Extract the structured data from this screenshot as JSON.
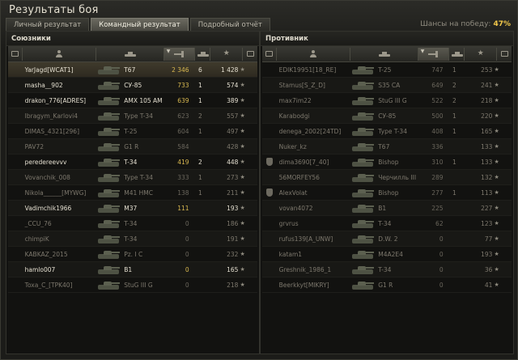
{
  "window": {
    "title": "Результаты боя"
  },
  "tabs": [
    {
      "label": "Личный результат"
    },
    {
      "label": "Командный результат"
    },
    {
      "label": "Подробный отчёт"
    }
  ],
  "win_chance": {
    "label": "Шансы на победу:",
    "value": "47%"
  },
  "allies": {
    "title": "Союзники",
    "rows": [
      {
        "name": "YarJagd[WCAT1]",
        "tank": "T67",
        "dmg": "2 346",
        "frags": "6",
        "xp": "1 428",
        "alive": true,
        "dmg_style": "Y",
        "medal": true,
        "highlight": true
      },
      {
        "name": "masha__902",
        "tank": "СУ-85",
        "dmg": "733",
        "frags": "1",
        "xp": "574",
        "alive": true,
        "dmg_style": "Y"
      },
      {
        "name": "drakon_776[ADRES]",
        "tank": "AMX 105 AM",
        "dmg": "639",
        "frags": "1",
        "xp": "389",
        "alive": true,
        "dmg_style": "Y"
      },
      {
        "name": "Ibragym_Karlovi4",
        "tank": "Type T-34",
        "dmg": "623",
        "frags": "2",
        "xp": "557",
        "alive": false,
        "dmg_style": "G"
      },
      {
        "name": "DIMAS_4321[296]",
        "tank": "T-25",
        "dmg": "604",
        "frags": "1",
        "xp": "497",
        "alive": false,
        "dmg_style": "G"
      },
      {
        "name": "PAV72",
        "tank": "G1 R",
        "dmg": "584",
        "frags": "",
        "xp": "428",
        "alive": false,
        "dmg_style": "G"
      },
      {
        "name": "peredereevvv",
        "tank": "T-34",
        "dmg": "419",
        "frags": "2",
        "xp": "448",
        "alive": true,
        "dmg_style": "Y"
      },
      {
        "name": "Vovanchik_008",
        "tank": "Type T-34",
        "dmg": "333",
        "frags": "1",
        "xp": "273",
        "alive": false,
        "dmg_style": "G"
      },
      {
        "name": "Nikola______[MYWG]",
        "tank": "M41 HMC",
        "dmg": "138",
        "frags": "1",
        "xp": "211",
        "alive": false,
        "dmg_style": "G"
      },
      {
        "name": "Vadimchik1966",
        "tank": "M37",
        "dmg": "111",
        "frags": "",
        "xp": "193",
        "alive": true,
        "dmg_style": "Y"
      },
      {
        "name": "_CCU_76",
        "tank": "T-34",
        "dmg": "0",
        "frags": "",
        "xp": "186",
        "alive": false,
        "dmg_style": "G"
      },
      {
        "name": "chimpiK",
        "tank": "T-34",
        "dmg": "0",
        "frags": "",
        "xp": "191",
        "alive": false,
        "dmg_style": "G"
      },
      {
        "name": "KABKAZ_2015",
        "tank": "Pz. I C",
        "dmg": "0",
        "frags": "",
        "xp": "232",
        "alive": false,
        "dmg_style": "G"
      },
      {
        "name": "hamlo007",
        "tank": "B1",
        "dmg": "0",
        "frags": "",
        "xp": "165",
        "alive": true,
        "dmg_style": "Y"
      },
      {
        "name": "Toxa_C_[TPK40]",
        "tank": "StuG III G",
        "dmg": "0",
        "frags": "",
        "xp": "218",
        "alive": false,
        "dmg_style": "G"
      }
    ]
  },
  "enemies": {
    "title": "Противник",
    "rows": [
      {
        "name": "EDIK19951[18_RE]",
        "tank": "T-25",
        "dmg": "747",
        "frags": "1",
        "xp": "253",
        "alive": false,
        "badge": false
      },
      {
        "name": "Stamus[S_Z_D]",
        "tank": "S35 CA",
        "dmg": "649",
        "frags": "2",
        "xp": "241",
        "alive": false,
        "badge": false
      },
      {
        "name": "max7im22",
        "tank": "StuG III G",
        "dmg": "522",
        "frags": "2",
        "xp": "218",
        "alive": false,
        "badge": false
      },
      {
        "name": "Karabodgi",
        "tank": "СУ-85",
        "dmg": "500",
        "frags": "1",
        "xp": "220",
        "alive": false,
        "badge": false
      },
      {
        "name": "denega_2002[24TD]",
        "tank": "Type T-34",
        "dmg": "408",
        "frags": "1",
        "xp": "165",
        "alive": false,
        "badge": false
      },
      {
        "name": "Nuker_kz",
        "tank": "T67",
        "dmg": "336",
        "frags": "",
        "xp": "133",
        "alive": false,
        "badge": false
      },
      {
        "name": "dima3690[7_40]",
        "tank": "Bishop",
        "dmg": "310",
        "frags": "1",
        "xp": "133",
        "alive": false,
        "badge": true
      },
      {
        "name": "56MORFEY56",
        "tank": "Черчилль III",
        "dmg": "289",
        "frags": "",
        "xp": "132",
        "alive": false,
        "badge": false
      },
      {
        "name": "AlexVolat",
        "tank": "Bishop",
        "dmg": "277",
        "frags": "1",
        "xp": "113",
        "alive": false,
        "badge": true
      },
      {
        "name": "vovan4072",
        "tank": "B1",
        "dmg": "225",
        "frags": "",
        "xp": "227",
        "alive": false,
        "badge": false
      },
      {
        "name": "grvrus",
        "tank": "T-34",
        "dmg": "62",
        "frags": "",
        "xp": "123",
        "alive": false,
        "badge": false
      },
      {
        "name": "rufus139[A_UNW]",
        "tank": "D.W. 2",
        "dmg": "0",
        "frags": "",
        "xp": "77",
        "alive": false,
        "badge": false
      },
      {
        "name": "katam1",
        "tank": "M4A2E4",
        "dmg": "0",
        "frags": "",
        "xp": "193",
        "alive": false,
        "badge": false
      },
      {
        "name": "Greshnik_1986_1",
        "tank": "T-34",
        "dmg": "0",
        "frags": "",
        "xp": "36",
        "alive": false,
        "badge": false
      },
      {
        "name": "Beerkkyt[MIKRY]",
        "tank": "G1 R",
        "dmg": "0",
        "frags": "",
        "xp": "41",
        "alive": false,
        "badge": false
      }
    ]
  },
  "icons": {
    "badge_col": "vehicle-type-icon",
    "player_col": "player-icon",
    "tank_col": "tank-icon",
    "damage_col": "damage-icon",
    "frags_col": "frags-icon",
    "xp_col": "star-icon",
    "medal_col": "medal-icon"
  },
  "colors": {
    "win_chance": "#f1c74a",
    "damage_yellow": "#d8b850"
  }
}
